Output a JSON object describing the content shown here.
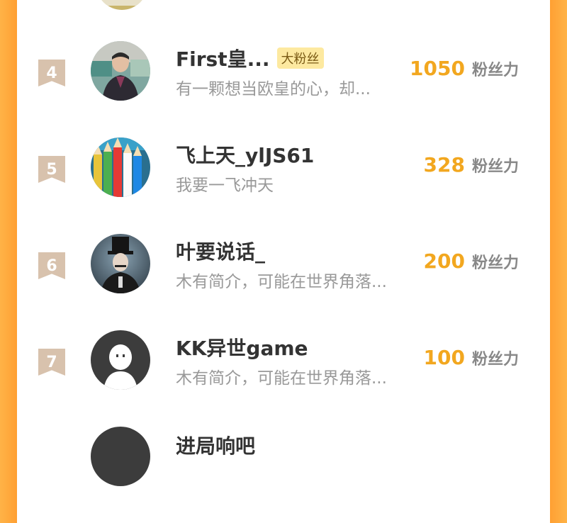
{
  "ranking": {
    "rows": [
      {
        "rank": "4",
        "name": "First皇...",
        "badge": "大粉丝",
        "bio": "有一颗想当欧皇的心，却...",
        "fans": "1050",
        "fans_label": "粉丝力",
        "avatar_icon": "man-suit-photo"
      },
      {
        "rank": "5",
        "name": "飞上天_ylJS61",
        "badge": "",
        "bio": "我要一飞冲天",
        "fans": "328",
        "fans_label": "粉丝力",
        "avatar_icon": "colored-pencils-photo"
      },
      {
        "rank": "6",
        "name": "叶要说话_",
        "badge": "",
        "bio": "木有简介，可能在世界角落...",
        "fans": "200",
        "fans_label": "粉丝力",
        "avatar_icon": "top-hat-man-photo"
      },
      {
        "rank": "7",
        "name": "KK异世game",
        "badge": "",
        "bio": "木有简介，可能在世界角落...",
        "fans": "100",
        "fans_label": "粉丝力",
        "avatar_icon": "default-avatar-icon"
      },
      {
        "rank": "",
        "name": "进局响吧",
        "badge": "",
        "bio": "",
        "fans": "",
        "fans_label": "",
        "avatar_icon": "dark-avatar"
      }
    ]
  },
  "colors": {
    "accent": "#f2a71f",
    "rank_bg": "#d8c2ad",
    "badge_bg": "#fde9a0",
    "side": "#ffa033"
  }
}
